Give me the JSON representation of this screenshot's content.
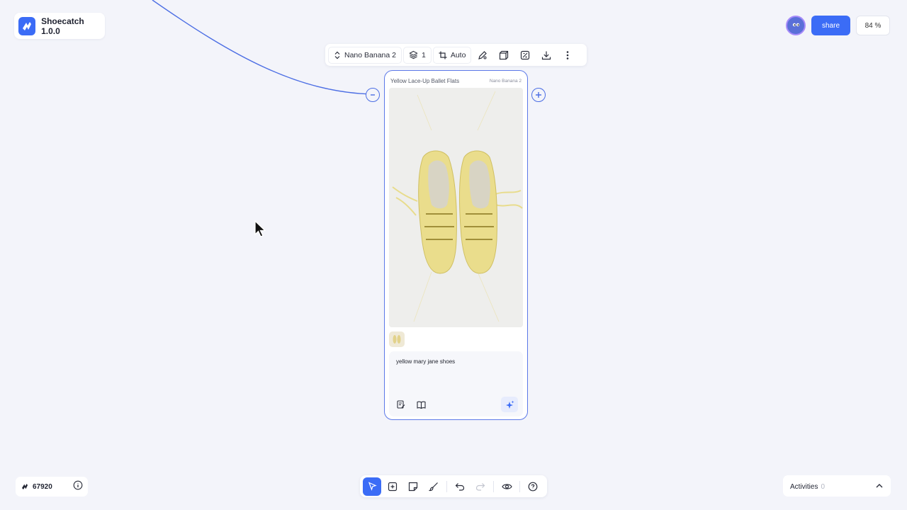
{
  "app": {
    "name": "Shoecatch 1.0.0",
    "brand_color": "#3b6cf6"
  },
  "header": {
    "share_label": "share",
    "zoom": "84 %"
  },
  "node_toolbar": {
    "model": "Nano Banana 2",
    "layers": "1",
    "aspect": "Auto",
    "icons": [
      "pencil-icon",
      "cube-icon",
      "image-adjust-icon",
      "download-icon",
      "more-vertical-icon"
    ]
  },
  "node": {
    "title": "Yellow Lace-Up Ballet Flats",
    "model": "Nano Banana 2",
    "prompt": "yellow mary jane shoes",
    "image_alt": "yellow lace-up ballet flats"
  },
  "credits": {
    "value": "67920"
  },
  "activities": {
    "label": "Activities",
    "count": "0"
  },
  "bottom_toolbar": {
    "tools": [
      "select",
      "add-node",
      "sticky-note",
      "brush",
      "undo",
      "redo",
      "preview",
      "help"
    ],
    "active": "select"
  }
}
